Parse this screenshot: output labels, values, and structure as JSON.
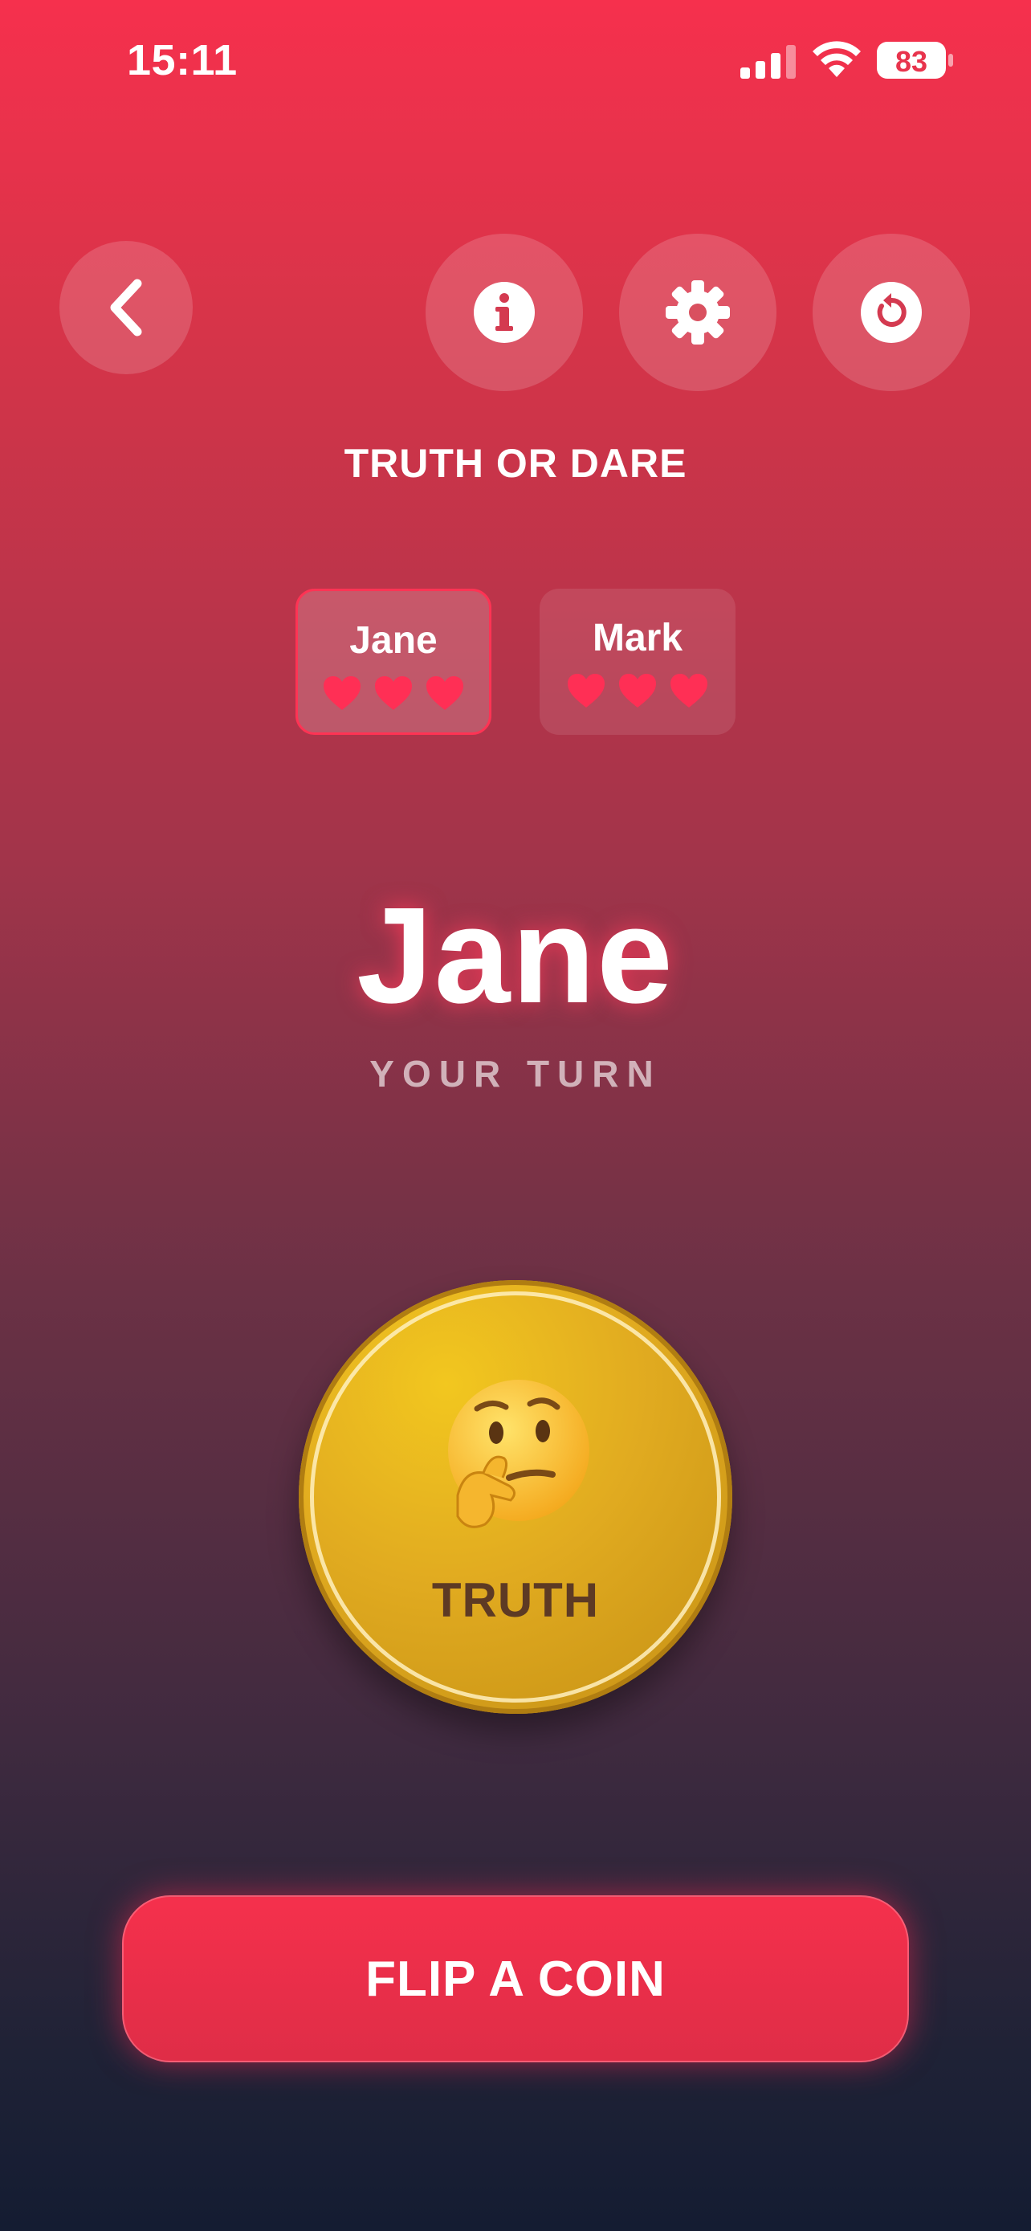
{
  "status_bar": {
    "time": "15:11",
    "battery": "83"
  },
  "header": {
    "title": "TRUTH OR DARE"
  },
  "players": [
    {
      "name": "Jane",
      "hearts": 3,
      "active": true
    },
    {
      "name": "Mark",
      "hearts": 3,
      "active": false
    }
  ],
  "turn": {
    "player": "Jane",
    "label": "YOUR TURN"
  },
  "coin": {
    "label": "TRUTH",
    "icon": "thinking-face-emoji"
  },
  "actions": {
    "flip_label": "FLIP A COIN"
  },
  "colors": {
    "accent": "#f5304c",
    "heart": "#ff2f55",
    "coin_gold": "#e1ab20",
    "coin_text": "#5d3a24"
  }
}
